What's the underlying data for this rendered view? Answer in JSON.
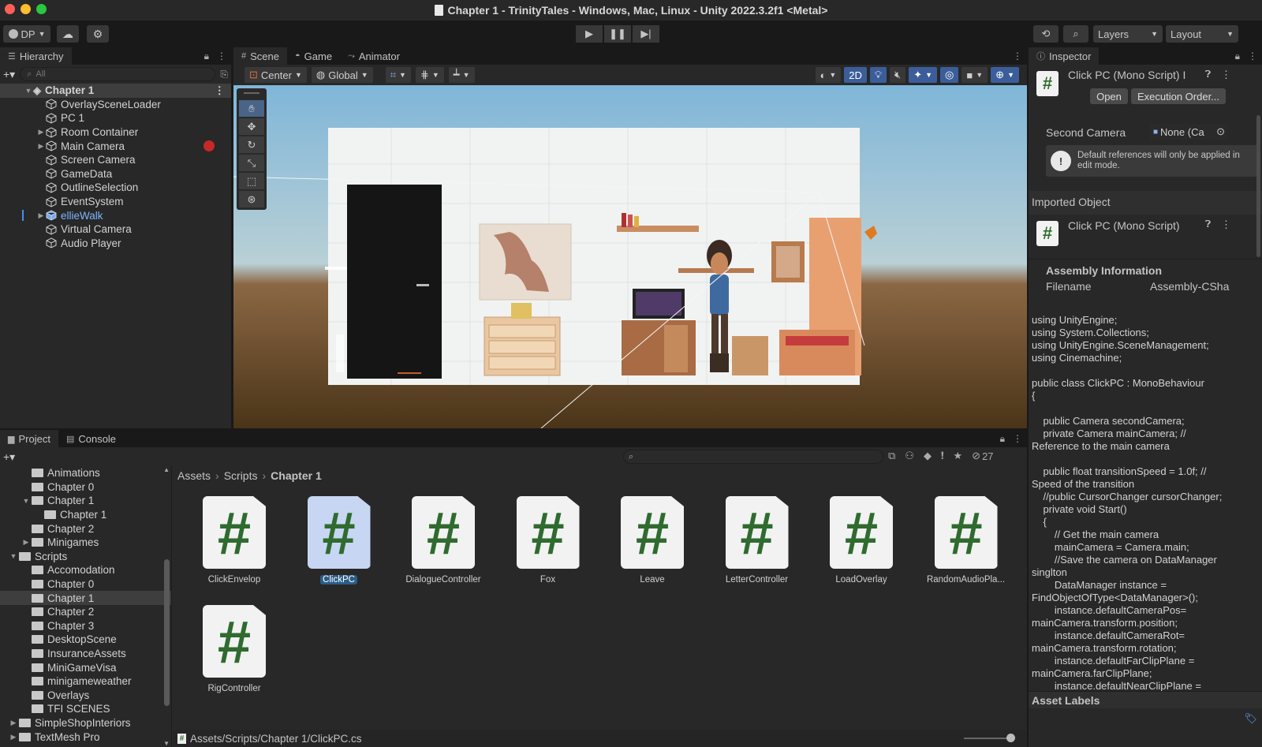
{
  "window": {
    "title": "Chapter 1 - TrinityTales - Windows, Mac, Linux - Unity 2022.3.2f1 <Metal>"
  },
  "toolbar": {
    "account": "DP",
    "layers_label": "Layers",
    "layout_label": "Layout"
  },
  "hierarchy": {
    "tab_label": "Hierarchy",
    "search_placeholder": "All",
    "scene_name": "Chapter 1",
    "items": [
      {
        "label": "OverlaySceneLoader",
        "arrow": ""
      },
      {
        "label": "PC 1",
        "arrow": ""
      },
      {
        "label": "Room Container",
        "arrow": "▶"
      },
      {
        "label": "Main Camera",
        "arrow": "▶"
      },
      {
        "label": "Screen Camera",
        "arrow": ""
      },
      {
        "label": "GameData",
        "arrow": ""
      },
      {
        "label": "OutlineSelection",
        "arrow": ""
      },
      {
        "label": "EventSystem",
        "arrow": ""
      },
      {
        "label": "ellieWalk",
        "arrow": "▶"
      },
      {
        "label": "Virtual Camera",
        "arrow": ""
      },
      {
        "label": "Audio Player",
        "arrow": ""
      }
    ]
  },
  "scene": {
    "tabs": {
      "scene": "Scene",
      "game": "Game",
      "animator": "Animator"
    },
    "pivot": "Center",
    "space": "Global",
    "mode_2d": "2D"
  },
  "project": {
    "tabs": {
      "project": "Project",
      "console": "Console"
    },
    "hidden_count": "27",
    "tree": [
      {
        "label": "Animations",
        "indent": 2,
        "arrow": ""
      },
      {
        "label": "Chapter 0",
        "indent": 2,
        "arrow": ""
      },
      {
        "label": "Chapter 1",
        "indent": 2,
        "arrow": "▼"
      },
      {
        "label": "Chapter 1",
        "indent": 3,
        "arrow": ""
      },
      {
        "label": "Chapter 2",
        "indent": 2,
        "arrow": ""
      },
      {
        "label": "Minigames",
        "indent": 2,
        "arrow": "▶"
      },
      {
        "label": "Scripts",
        "indent": 1,
        "arrow": "▼"
      },
      {
        "label": "Accomodation",
        "indent": 2,
        "arrow": ""
      },
      {
        "label": "Chapter 0",
        "indent": 2,
        "arrow": ""
      },
      {
        "label": "Chapter 1",
        "indent": 2,
        "arrow": ""
      },
      {
        "label": "Chapter 2",
        "indent": 2,
        "arrow": ""
      },
      {
        "label": "Chapter 3",
        "indent": 2,
        "arrow": ""
      },
      {
        "label": "DesktopScene",
        "indent": 2,
        "arrow": ""
      },
      {
        "label": "InsuranceAssets",
        "indent": 2,
        "arrow": ""
      },
      {
        "label": "MiniGameVisa",
        "indent": 2,
        "arrow": ""
      },
      {
        "label": "minigameweather",
        "indent": 2,
        "arrow": ""
      },
      {
        "label": "Overlays",
        "indent": 2,
        "arrow": ""
      },
      {
        "label": "TFI SCENES",
        "indent": 2,
        "arrow": ""
      },
      {
        "label": "SimpleShopInteriors",
        "indent": 1,
        "arrow": "▶"
      },
      {
        "label": "TextMesh Pro",
        "indent": 1,
        "arrow": "▶"
      }
    ],
    "breadcrumb": [
      "Assets",
      "Scripts",
      "Chapter 1"
    ],
    "assets": [
      "ClickEnvelop",
      "ClickPC",
      "DialogueController",
      "Fox",
      "Leave",
      "LetterController",
      "LoadOverlay",
      "RandomAudioPla...",
      "RigController"
    ],
    "selected_asset": "ClickPC",
    "status_path": "Assets/Scripts/Chapter 1/ClickPC.cs"
  },
  "inspector": {
    "tab_label": "Inspector",
    "script_title": "Click PC (Mono Script) I",
    "open_button": "Open",
    "exec_order_button": "Execution Order...",
    "second_camera_label": "Second Camera",
    "second_camera_value": "None (Ca",
    "info_message": "Default references will only be applied in edit mode.",
    "imported_object_label": "Imported Object",
    "imported_title": "Click PC (Mono Script)",
    "assembly_header": "Assembly Information",
    "filename_label": "Filename",
    "filename_value": "Assembly-CSha",
    "asset_labels": "Asset Labels",
    "code": "using UnityEngine;\nusing System.Collections;\nusing UnityEngine.SceneManagement;\nusing Cinemachine;\n\npublic class ClickPC : MonoBehaviour\n{\n\n    public Camera secondCamera;\n    private Camera mainCamera; // Reference to the main camera\n\n    public float transitionSpeed = 1.0f; // Speed of the transition\n    //public CursorChanger cursorChanger;\n    private void Start()\n    {\n        // Get the main camera\n        mainCamera = Camera.main;\n        //Save the camera on DataManager singlton\n        DataManager instance = FindObjectOfType<DataManager>();\n        instance.defaultCameraPos= mainCamera.transform.position;\n        instance.defaultCameraRot= mainCamera.transform.rotation;\n        instance.defaultFarClipPlane = mainCamera.farClipPlane;\n        instance.defaultNearClipPlane ="
  }
}
